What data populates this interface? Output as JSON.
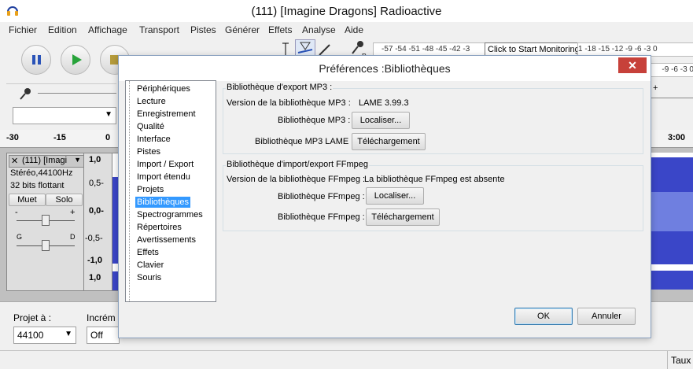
{
  "window": {
    "title": "(111) [Imagine Dragons] Radioactive"
  },
  "menu": [
    "Fichier",
    "Edition",
    "Affichage",
    "Transport",
    "Pistes",
    "Générer",
    "Effets",
    "Analyse",
    "Aide"
  ],
  "toolbar": {
    "meter_tooltip": "Click to Start Monitoring",
    "meter_scale": "-57 -54 -51 -48 -45 -42 -3",
    "meter_scale_right": "1 -18 -15 -12 -9 -6 -3 0",
    "meter_scale_right2": "-9 -6 -3 0",
    "meter_right_label": "R",
    "meter_left_label": "L"
  },
  "ruler": {
    "ticks": [
      "-30",
      "-15",
      "0",
      "3:00"
    ]
  },
  "track": {
    "name": "(111) [Imagi",
    "info1": "Stéréo,44100Hz",
    "info2": "32 bits flottant",
    "mute": "Muet",
    "solo": "Solo",
    "gain_minus": "-",
    "gain_plus": "+",
    "pan_left": "G",
    "pan_right": "D",
    "scale": [
      "1,0",
      "0,5-",
      "0,0-",
      "-0,5-",
      "-1,0",
      "1,0"
    ]
  },
  "bottom": {
    "project_rate_label": "Projet à :",
    "project_rate_value": "44100",
    "snap_label": "Incrém",
    "snap_value": "Off"
  },
  "status": {
    "rate": "Taux"
  },
  "dialog": {
    "title": "Préférences :Bibliothèques",
    "close": "✕",
    "nav": [
      "Périphériques",
      "Lecture",
      "Enregistrement",
      "Qualité",
      "Interface",
      "Pistes",
      "Import / Export",
      "Import étendu",
      "Projets",
      "Bibliothèques",
      "Spectrogrammes",
      "Répertoires",
      "Avertissements",
      "Effets",
      "Clavier",
      "Souris"
    ],
    "selected_index": 9,
    "mp3": {
      "group_label": "Bibliothèque d'export MP3 :",
      "version_label": "Version de la bibliothèque MP3 :",
      "version_value": "LAME 3.99.3",
      "lib_label": "Bibliothèque MP3 :",
      "locate_button": "Localiser...",
      "lame_label": "Bibliothèque MP3 LAME :",
      "download_button": "Téléchargement"
    },
    "ffmpeg": {
      "group_label": "Bibliothèque d'import/export FFmpeg",
      "version_label": "Version de la bibliothèque FFmpeg :",
      "version_value": "La bibliothèque FFmpeg est absente",
      "lib_label": "Bibliothèque FFmpeg :",
      "locate_button": "Localiser...",
      "lib_label2": "Bibliothèque FFmpeg :",
      "download_button": "Téléchargement"
    },
    "ok": "OK",
    "cancel": "Annuler"
  }
}
